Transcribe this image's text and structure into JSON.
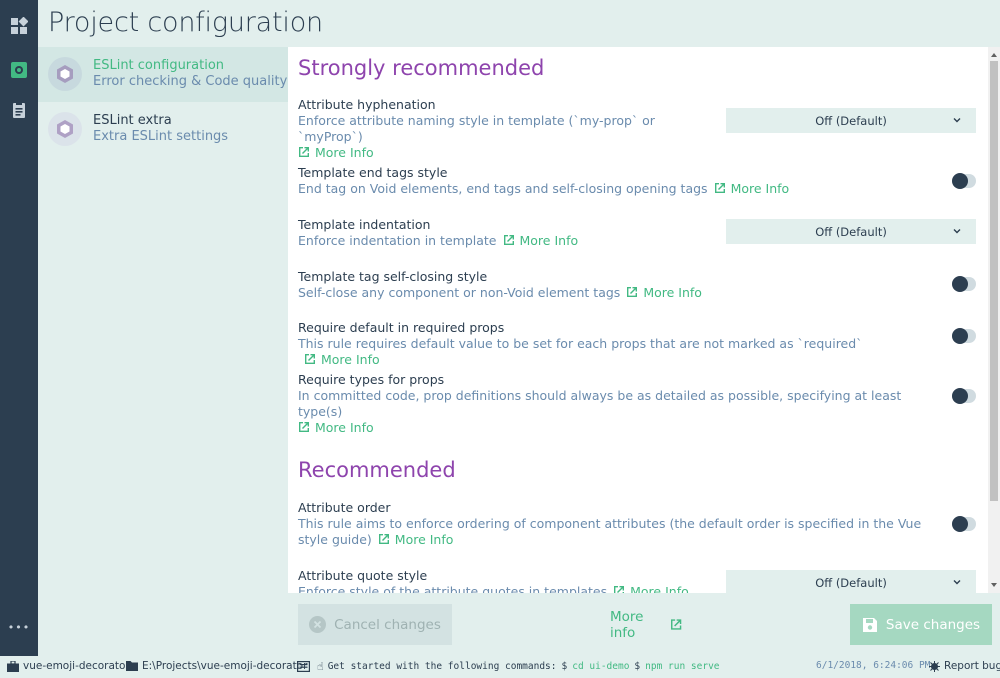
{
  "header": {
    "title": "Project configuration"
  },
  "nav": {
    "items": [
      {
        "icon": "dashboard-icon"
      },
      {
        "icon": "plugin-icon"
      },
      {
        "icon": "clipboard-icon"
      }
    ],
    "more": "•••"
  },
  "sidebar": {
    "items": [
      {
        "icon": "eslint-icon",
        "title": "ESLint configuration",
        "subtitle": "Error checking & Code quality",
        "selected": true
      },
      {
        "icon": "eslint-icon",
        "title": "ESLint extra",
        "subtitle": "Extra ESLint settings",
        "selected": false
      }
    ]
  },
  "sections": [
    {
      "title": "Strongly recommended",
      "rules": [
        {
          "name": "Attribute hyphenation",
          "desc": "Enforce attribute naming style in template (`my-prop` or `myProp`)",
          "more": "More Info",
          "control": "select",
          "value": "Off (Default)"
        },
        {
          "name": "Template end tags style",
          "desc": "End tag on Void elements, end tags and self-closing opening tags",
          "more": "More Info",
          "control": "toggle"
        },
        {
          "name": "Template indentation",
          "desc": "Enforce indentation in template",
          "more": "More Info",
          "control": "select",
          "value": "Off (Default)"
        },
        {
          "name": "Template tag self-closing style",
          "desc": "Self-close any component or non-Void element tags",
          "more": "More Info",
          "control": "toggle"
        },
        {
          "name": "Require default in required props",
          "desc": "This rule requires default value to be set for each props that are not marked as `required`",
          "more": "More Info",
          "control": "toggle"
        },
        {
          "name": "Require types for props",
          "desc": "In committed code, prop definitions should always be as detailed as possible, specifying at least type(s)",
          "more": "More Info",
          "control": "toggle"
        }
      ]
    },
    {
      "title": "Recommended",
      "rules": [
        {
          "name": "Attribute order",
          "desc": "This rule aims to enforce ordering of component attributes (the default order is specified in the Vue style guide)",
          "more": "More Info",
          "control": "toggle"
        },
        {
          "name": "Attribute quote style",
          "desc": "Enforce style of the attribute quotes in templates",
          "more": "More Info",
          "control": "select",
          "value": "Off (Default)"
        }
      ]
    }
  ],
  "actions": {
    "cancel": "Cancel changes",
    "more_info": "More info",
    "save": "Save changes"
  },
  "status": {
    "project": "vue-emoji-decorator",
    "path": "E:\\Projects\\vue-emoji-decorator",
    "hint": "Get started with the following commands:",
    "prompt1": "$",
    "cmd1": "cd ui-demo",
    "prompt2": "$",
    "cmd2": "npm run serve",
    "time": "6/1/2018, 6:24:06 PM",
    "report": "Report bug"
  },
  "colors": {
    "accent": "#42b983",
    "section": "#8e44ad",
    "nav": "#2c3e50",
    "bg": "#e2efed"
  }
}
